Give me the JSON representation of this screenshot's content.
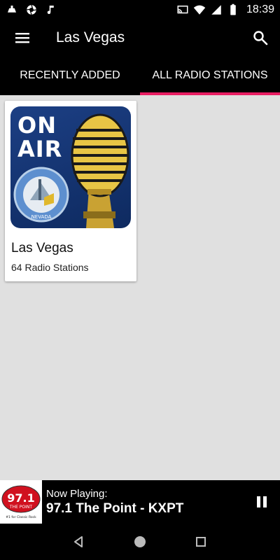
{
  "status_bar": {
    "time": "18:39",
    "left_icons": [
      "cloud-download-icon",
      "shutter-icon",
      "music-note-icon"
    ],
    "right_icons": [
      "cast-icon",
      "wifi-icon",
      "signal-icon",
      "battery-icon"
    ]
  },
  "toolbar": {
    "title": "Las Vegas",
    "menu_icon": "hamburger-menu-icon",
    "search_icon": "search-icon"
  },
  "tabs": [
    {
      "label": "Recently Added",
      "active": false
    },
    {
      "label": "All Radio Stations",
      "active": true
    }
  ],
  "card": {
    "art_text_line1": "ON",
    "art_text_line2": "AIR",
    "seal_text": "NEVADA",
    "title": "Las Vegas",
    "subtitle": "64 Radio Stations"
  },
  "now_playing": {
    "label": "Now Playing:",
    "station": "97.1 The Point - KXPT",
    "logo_number": "97.1",
    "logo_name": "THE POINT",
    "logo_tagline": "#1 for Classic Rock",
    "control": "pause-icon"
  },
  "nav_bar": {
    "items": [
      "back-icon",
      "home-icon",
      "recents-icon"
    ]
  },
  "colors": {
    "accent": "#e91e63",
    "bar_background": "#000000",
    "content_background": "#e0e0e0",
    "logo_red": "#d0111f"
  }
}
